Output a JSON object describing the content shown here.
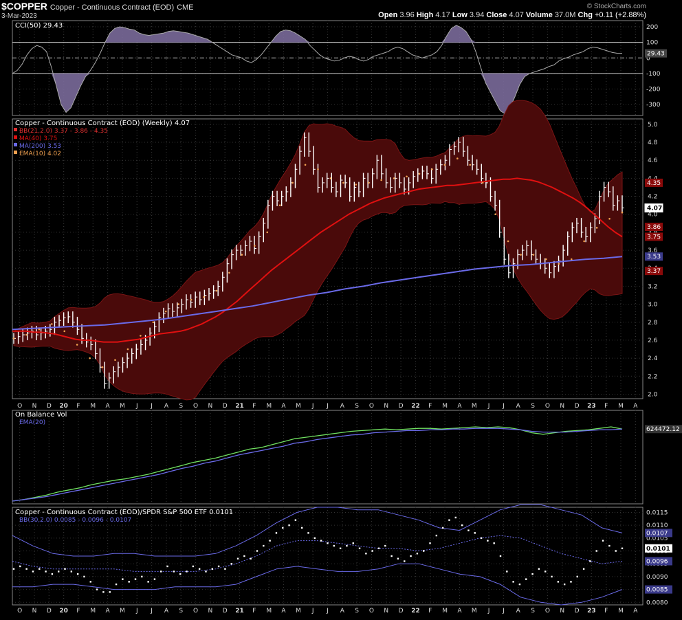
{
  "header": {
    "symbol": "$COPPER",
    "name": "Copper - Continuous Contract (EOD)",
    "exchange": "CME",
    "date": "3-Mar-2023",
    "brand": "© StockCharts.com",
    "open_label": "Open",
    "open": "3.96",
    "high_label": "High",
    "high": "4.17",
    "low_label": "Low",
    "low": "3.94",
    "close_label": "Close",
    "close": "4.07",
    "volume_label": "Volume",
    "volume": "37.0M",
    "chg_label": "Chg",
    "chg": "+0.11 (+2.88%)"
  },
  "colors": {
    "price_bar": "#ffffff",
    "bollinger_fill": "#4a0a0a",
    "bollinger_line": "#7a1414",
    "ma40": "#e01010",
    "ma200": "#6a6ae8",
    "ema10": "#f0a050",
    "obv": "#70e060",
    "obv_ema": "#6a6ae8",
    "cci_fill": "#7a6a9a",
    "cci_line": "#aaaaaa"
  },
  "chart_data": [
    {
      "type": "area",
      "panel": "cci",
      "legend": "CCI(50) 29.43",
      "ticks": [
        200,
        100,
        0,
        -100,
        -200,
        -300
      ],
      "ylim": [
        -370,
        240
      ],
      "reference_lines": [
        100,
        0,
        -100
      ],
      "last_value": "29.43",
      "values": [
        -100,
        -80,
        -40,
        20,
        60,
        80,
        70,
        40,
        -60,
        -180,
        -300,
        -350,
        -320,
        -250,
        -180,
        -120,
        -80,
        -30,
        30,
        100,
        160,
        190,
        200,
        195,
        185,
        180,
        160,
        150,
        145,
        150,
        155,
        160,
        170,
        175,
        170,
        165,
        160,
        150,
        140,
        130,
        120,
        100,
        80,
        60,
        40,
        20,
        10,
        0,
        -20,
        -30,
        -10,
        20,
        60,
        100,
        140,
        170,
        180,
        175,
        160,
        140,
        120,
        80,
        50,
        20,
        0,
        -10,
        -20,
        -15,
        0,
        10,
        5,
        -10,
        -20,
        -10,
        10,
        20,
        30,
        40,
        60,
        70,
        60,
        40,
        20,
        10,
        0,
        10,
        20,
        40,
        80,
        140,
        190,
        210,
        195,
        170,
        120,
        40,
        -60,
        -160,
        -220,
        -280,
        -340,
        -360,
        -320,
        -250,
        -170,
        -120,
        -100,
        -90,
        -80,
        -70,
        -55,
        -45,
        -20,
        -5,
        5,
        20,
        30,
        40,
        60,
        70,
        65,
        55,
        45,
        35,
        30,
        29.43
      ]
    },
    {
      "type": "line",
      "panel": "price",
      "title": "Copper - Continuous Contract (EOD) (Weekly) 4.07",
      "ticks": [
        5.0,
        4.8,
        4.6,
        4.4,
        4.2,
        4.0,
        3.8,
        3.6,
        3.4,
        3.2,
        3.0,
        2.8,
        2.6,
        2.4,
        2.2,
        2.0
      ],
      "ylim": [
        1.95,
        5.06
      ],
      "x_ticks": [
        "O",
        "N",
        "D",
        "20",
        "F",
        "M",
        "A",
        "M",
        "J",
        "J",
        "A",
        "S",
        "O",
        "N",
        "D",
        "21",
        "F",
        "M",
        "A",
        "M",
        "J",
        "J",
        "A",
        "S",
        "O",
        "N",
        "D",
        "22",
        "F",
        "M",
        "A",
        "M",
        "J",
        "J",
        "A",
        "S",
        "O",
        "N",
        "D",
        "23",
        "F",
        "M",
        "A"
      ],
      "legend": [
        {
          "text": "BB(21,2.0) 3.37 - 3.86 - 4.35",
          "color": "#e03030"
        },
        {
          "text": "MA(40) 3.75",
          "color": "#e01010"
        },
        {
          "text": "MA(200) 3.53",
          "color": "#6a6ae8"
        },
        {
          "text": "EMA(10) 4.02",
          "color": "#f0a050"
        }
      ],
      "value_tags": [
        {
          "label": "4.35",
          "value": 4.35,
          "color": "#8a0a0a"
        },
        {
          "label": "4.07",
          "value": 4.07,
          "color": "#ffffff"
        },
        {
          "label": "3.86",
          "value": 3.86,
          "color": "#8a0a0a"
        },
        {
          "label": "3.75",
          "value": 3.75,
          "color": "#8a0a0a"
        },
        {
          "label": "3.53",
          "value": 3.53,
          "color": "#3a3a8a"
        },
        {
          "label": "3.37",
          "value": 3.37,
          "color": "#8a0a0a"
        }
      ],
      "close": [
        2.62,
        2.64,
        2.66,
        2.68,
        2.7,
        2.66,
        2.68,
        2.7,
        2.72,
        2.8,
        2.82,
        2.85,
        2.86,
        2.8,
        2.72,
        2.62,
        2.58,
        2.55,
        2.45,
        2.3,
        2.12,
        2.18,
        2.25,
        2.3,
        2.35,
        2.4,
        2.45,
        2.5,
        2.55,
        2.6,
        2.68,
        2.75,
        2.85,
        2.9,
        2.95,
        2.92,
        2.96,
        3.0,
        3.05,
        3.02,
        3.08,
        3.05,
        3.1,
        3.12,
        3.15,
        3.2,
        3.3,
        3.45,
        3.55,
        3.6,
        3.6,
        3.65,
        3.7,
        3.62,
        3.75,
        3.9,
        4.1,
        4.2,
        4.15,
        4.2,
        4.25,
        4.35,
        4.5,
        4.7,
        4.85,
        4.7,
        4.5,
        4.3,
        4.35,
        4.4,
        4.3,
        4.25,
        4.38,
        4.35,
        4.2,
        4.3,
        4.25,
        4.4,
        4.35,
        4.45,
        4.6,
        4.45,
        4.35,
        4.3,
        4.4,
        4.35,
        4.28,
        4.35,
        4.42,
        4.45,
        4.48,
        4.45,
        4.4,
        4.5,
        4.55,
        4.6,
        4.72,
        4.75,
        4.8,
        4.7,
        4.6,
        4.55,
        4.5,
        4.4,
        4.35,
        4.2,
        4.1,
        3.8,
        3.5,
        3.35,
        3.45,
        3.55,
        3.6,
        3.65,
        3.55,
        3.5,
        3.45,
        3.4,
        3.35,
        3.42,
        3.48,
        3.6,
        3.75,
        3.85,
        3.9,
        3.8,
        3.75,
        3.85,
        3.95,
        4.2,
        4.3,
        4.25,
        4.1,
        4.15,
        4.07
      ],
      "series": [
        {
          "name": "MA(40)",
          "values": [
            2.7,
            2.7,
            2.7,
            2.69,
            2.69,
            2.68,
            2.67,
            2.65,
            2.63,
            2.61,
            2.6,
            2.6,
            2.59,
            2.58,
            2.58,
            2.58,
            2.59,
            2.6,
            2.61,
            2.63,
            2.65,
            2.67,
            2.68,
            2.69,
            2.7,
            2.72,
            2.75,
            2.78,
            2.82,
            2.86,
            2.91,
            2.97,
            3.03,
            3.1,
            3.17,
            3.24,
            3.31,
            3.38,
            3.44,
            3.5,
            3.56,
            3.62,
            3.68,
            3.74,
            3.8,
            3.85,
            3.9,
            3.95,
            4.0,
            4.04,
            4.08,
            4.12,
            4.15,
            4.18,
            4.2,
            4.22,
            4.24,
            4.26,
            4.28,
            4.29,
            4.3,
            4.31,
            4.32,
            4.32,
            4.33,
            4.34,
            4.35,
            4.36,
            4.37,
            4.38,
            4.39,
            4.39,
            4.4,
            4.39,
            4.38,
            4.36,
            4.33,
            4.3,
            4.26,
            4.22,
            4.18,
            4.13,
            4.07,
            4.0,
            3.93,
            3.86,
            3.8,
            3.75
          ]
        },
        {
          "name": "MA(200)",
          "values": [
            2.72,
            2.73,
            2.74,
            2.75,
            2.76,
            2.77,
            2.79,
            2.81,
            2.83,
            2.86,
            2.89,
            2.92,
            2.95,
            2.98,
            3.02,
            3.06,
            3.1,
            3.13,
            3.17,
            3.2,
            3.24,
            3.27,
            3.3,
            3.33,
            3.36,
            3.39,
            3.41,
            3.43,
            3.44,
            3.46,
            3.48,
            3.5,
            3.51,
            3.53
          ]
        },
        {
          "name": "EMA(10)",
          "values": [
            2.62,
            2.66,
            2.72,
            2.78,
            2.7,
            2.55,
            2.4,
            2.3,
            2.38,
            2.5,
            2.65,
            2.8,
            2.92,
            3.0,
            3.05,
            3.08,
            3.15,
            3.35,
            3.55,
            3.65,
            3.8,
            4.1,
            4.35,
            4.55,
            4.5,
            4.4,
            4.35,
            4.33,
            4.35,
            4.38,
            4.4,
            4.42,
            4.45,
            4.5,
            4.55,
            4.62,
            4.55,
            4.35,
            4.0,
            3.7,
            3.55,
            3.55,
            3.5,
            3.45,
            3.5,
            3.7,
            3.85,
            3.95,
            4.02
          ]
        }
      ]
    },
    {
      "type": "line",
      "panel": "obv",
      "title": "On Balance Volume",
      "legend": [
        {
          "text": "On Balance Vol",
          "color": "#70e060"
        },
        {
          "text": "EMA(20)",
          "color": "#6a6ae8"
        }
      ],
      "last_value": "624472.12",
      "series": [
        {
          "name": "On Balance Vol",
          "values": [
            0.0,
            0.02,
            0.05,
            0.08,
            0.12,
            0.15,
            0.18,
            0.22,
            0.25,
            0.28,
            0.3,
            0.33,
            0.36,
            0.4,
            0.44,
            0.48,
            0.52,
            0.55,
            0.58,
            0.62,
            0.66,
            0.7,
            0.72,
            0.76,
            0.8,
            0.84,
            0.86,
            0.88,
            0.9,
            0.92,
            0.94,
            0.95,
            0.96,
            0.97,
            0.96,
            0.97,
            0.98,
            0.98,
            0.97,
            0.98,
            0.99,
            1.0,
            0.99,
            1.0,
            0.99,
            0.96,
            0.92,
            0.9,
            0.92,
            0.94,
            0.95,
            0.96,
            0.98,
            1.0,
            0.97
          ]
        },
        {
          "name": "EMA(20)",
          "values": [
            0.0,
            0.02,
            0.04,
            0.06,
            0.09,
            0.12,
            0.15,
            0.18,
            0.21,
            0.24,
            0.27,
            0.3,
            0.33,
            0.36,
            0.4,
            0.44,
            0.47,
            0.51,
            0.54,
            0.58,
            0.62,
            0.65,
            0.68,
            0.71,
            0.74,
            0.78,
            0.8,
            0.83,
            0.85,
            0.87,
            0.89,
            0.9,
            0.92,
            0.93,
            0.94,
            0.95,
            0.95,
            0.96,
            0.96,
            0.97,
            0.97,
            0.98,
            0.98,
            0.98,
            0.97,
            0.96,
            0.94,
            0.93,
            0.93,
            0.93,
            0.94,
            0.95,
            0.96,
            0.96,
            0.97
          ]
        }
      ]
    },
    {
      "type": "scatter",
      "panel": "ratio",
      "title": "Copper - Continuous Contract (EOD)/SPDR S&P 500 ETF 0.0101",
      "legend": [
        {
          "text": "Copper - Continuous Contract (EOD)/SPDR S&P 500 ETF 0.0101",
          "color": "#ffffff"
        },
        {
          "text": "BB(30,2.0) 0.0085 - 0.0096 - 0.0107",
          "color": "#6a6ae8"
        }
      ],
      "ticks": [
        0.0115,
        0.011,
        0.0105,
        0.01,
        0.0095,
        0.009,
        0.0085,
        0.008
      ],
      "ylim": [
        0.0079,
        0.0117
      ],
      "value_tags": [
        {
          "label": "0.0107",
          "value": 0.0107,
          "color": "#3a3a8a"
        },
        {
          "label": "0.0101",
          "value": 0.0101,
          "color": "#ffffff"
        },
        {
          "label": "0.0096",
          "value": 0.0096,
          "color": "#3a3a8a"
        },
        {
          "label": "0.0085",
          "value": 0.0085,
          "color": "#3a3a8a"
        }
      ],
      "x_ticks": [
        "O",
        "N",
        "D",
        "20",
        "F",
        "M",
        "A",
        "M",
        "J",
        "J",
        "A",
        "S",
        "O",
        "N",
        "D",
        "21",
        "F",
        "M",
        "A",
        "M",
        "J",
        "J",
        "A",
        "S",
        "O",
        "N",
        "D",
        "22",
        "F",
        "M",
        "A",
        "M",
        "J",
        "J",
        "A",
        "S",
        "O",
        "N",
        "D",
        "23",
        "F",
        "M",
        "A"
      ],
      "values": [
        0.0093,
        0.0094,
        0.0093,
        0.0092,
        0.0093,
        0.0092,
        0.0091,
        0.0092,
        0.0093,
        0.0092,
        0.0091,
        0.009,
        0.0088,
        0.0085,
        0.0084,
        0.0084,
        0.0087,
        0.0089,
        0.0088,
        0.0089,
        0.009,
        0.0088,
        0.0089,
        0.0092,
        0.0094,
        0.0092,
        0.0091,
        0.0092,
        0.0094,
        0.0093,
        0.0092,
        0.0093,
        0.0094,
        0.0093,
        0.0095,
        0.0097,
        0.0098,
        0.0097,
        0.01,
        0.0102,
        0.0104,
        0.0107,
        0.0109,
        0.011,
        0.0112,
        0.0109,
        0.0107,
        0.0105,
        0.0104,
        0.0103,
        0.0102,
        0.0101,
        0.0102,
        0.0103,
        0.0101,
        0.0099,
        0.01,
        0.0101,
        0.0102,
        0.0098,
        0.0097,
        0.0096,
        0.0098,
        0.0099,
        0.01,
        0.0103,
        0.0106,
        0.0109,
        0.0112,
        0.0113,
        0.011,
        0.0108,
        0.0107,
        0.0105,
        0.0104,
        0.0103,
        0.0098,
        0.0092,
        0.0088,
        0.0087,
        0.0089,
        0.0091,
        0.0093,
        0.0092,
        0.009,
        0.0088,
        0.0087,
        0.0088,
        0.009,
        0.0093,
        0.0096,
        0.01,
        0.0104,
        0.0102,
        0.01,
        0.0101
      ],
      "series": [
        {
          "name": "BB upper",
          "values": [
            0.0106,
            0.0102,
            0.0099,
            0.0098,
            0.0098,
            0.0099,
            0.0099,
            0.0098,
            0.0098,
            0.0098,
            0.0099,
            0.0102,
            0.0106,
            0.0111,
            0.0115,
            0.0117,
            0.0117,
            0.0116,
            0.0116,
            0.0114,
            0.0112,
            0.0109,
            0.0108,
            0.0112,
            0.0116,
            0.0118,
            0.0118,
            0.0116,
            0.0114,
            0.0109,
            0.0107
          ]
        },
        {
          "name": "BB mid",
          "values": [
            0.0096,
            0.0094,
            0.0093,
            0.0093,
            0.0093,
            0.0093,
            0.0092,
            0.0092,
            0.0092,
            0.0092,
            0.0093,
            0.0095,
            0.0098,
            0.0102,
            0.0104,
            0.0104,
            0.0103,
            0.0102,
            0.0101,
            0.0101,
            0.01,
            0.0101,
            0.0103,
            0.0105,
            0.0106,
            0.0105,
            0.0102,
            0.0099,
            0.0097,
            0.0095,
            0.0096
          ]
        },
        {
          "name": "BB lower",
          "values": [
            0.0086,
            0.0086,
            0.0087,
            0.0087,
            0.0086,
            0.0085,
            0.0085,
            0.0085,
            0.0086,
            0.0086,
            0.0086,
            0.0087,
            0.009,
            0.0093,
            0.0094,
            0.0093,
            0.0092,
            0.0092,
            0.0093,
            0.0095,
            0.0095,
            0.0093,
            0.0091,
            0.009,
            0.0087,
            0.0082,
            0.008,
            0.0079,
            0.008,
            0.0082,
            0.0085
          ]
        }
      ]
    }
  ]
}
